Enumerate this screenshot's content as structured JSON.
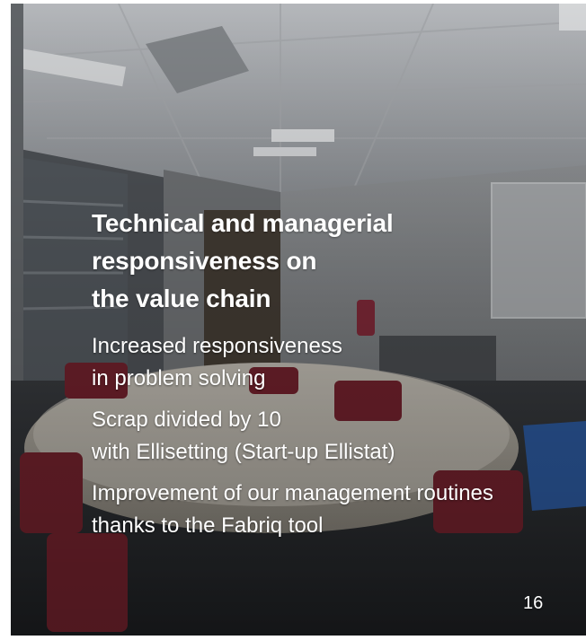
{
  "slide": {
    "title_lines": [
      "Technical and managerial",
      "responsiveness on",
      "the value chain"
    ],
    "bullets": [
      {
        "lines": [
          "Increased responsiveness",
          "in problem solving"
        ]
      },
      {
        "lines": [
          "Scrap divided by 10",
          "with Ellisetting (Start-up Ellistat)"
        ]
      },
      {
        "lines": [
          "Improvement of our management routines",
          "thanks to the Fabriq tool"
        ]
      }
    ],
    "page_number": "16",
    "background_image": "meeting-room-photo"
  },
  "colors": {
    "text": "#ffffff",
    "overlay": "#000000"
  }
}
